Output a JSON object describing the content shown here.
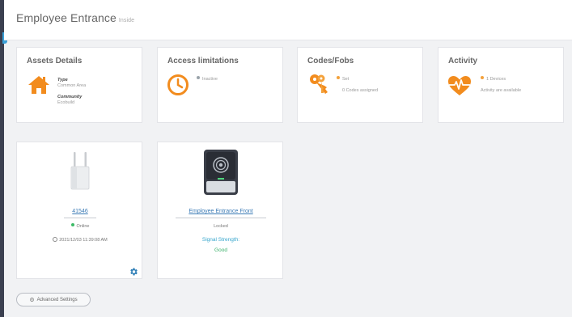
{
  "header": {
    "title": "Employee Entrance",
    "subtitle": "Inside"
  },
  "cards": {
    "assets": {
      "title": "Assets Details",
      "type_label": "Type",
      "type_value": "Common Area",
      "community_label": "Community",
      "community_value": "Ecobuild",
      "icon": "home-icon"
    },
    "access": {
      "title": "Access limitations",
      "status": "Inactive",
      "icon": "clock-icon"
    },
    "codes": {
      "title": "Codes/Fobs",
      "status": "Set",
      "note": "0 Codes assigned",
      "icon": "keys-icon"
    },
    "activity": {
      "title": "Activity",
      "status": "1 Devices",
      "note": "Activity are available",
      "icon": "heartbeat-icon"
    }
  },
  "devices": [
    {
      "name": "41546",
      "status": "Online",
      "timestamp": "2021/12/03 11:39:08 AM",
      "icon": "gateway-router-icon"
    },
    {
      "name": "Employee Entrance Front",
      "lock_state": "Locked",
      "signal_label": "Signal Strength:",
      "signal_value": "Good",
      "icon": "smart-lock-icon"
    }
  ],
  "actions": {
    "advanced_settings": "Advanced Settings"
  },
  "colors": {
    "accent_orange": "#f28c1e",
    "accent_blue": "#35a5cc",
    "rail": "#3b4050"
  }
}
